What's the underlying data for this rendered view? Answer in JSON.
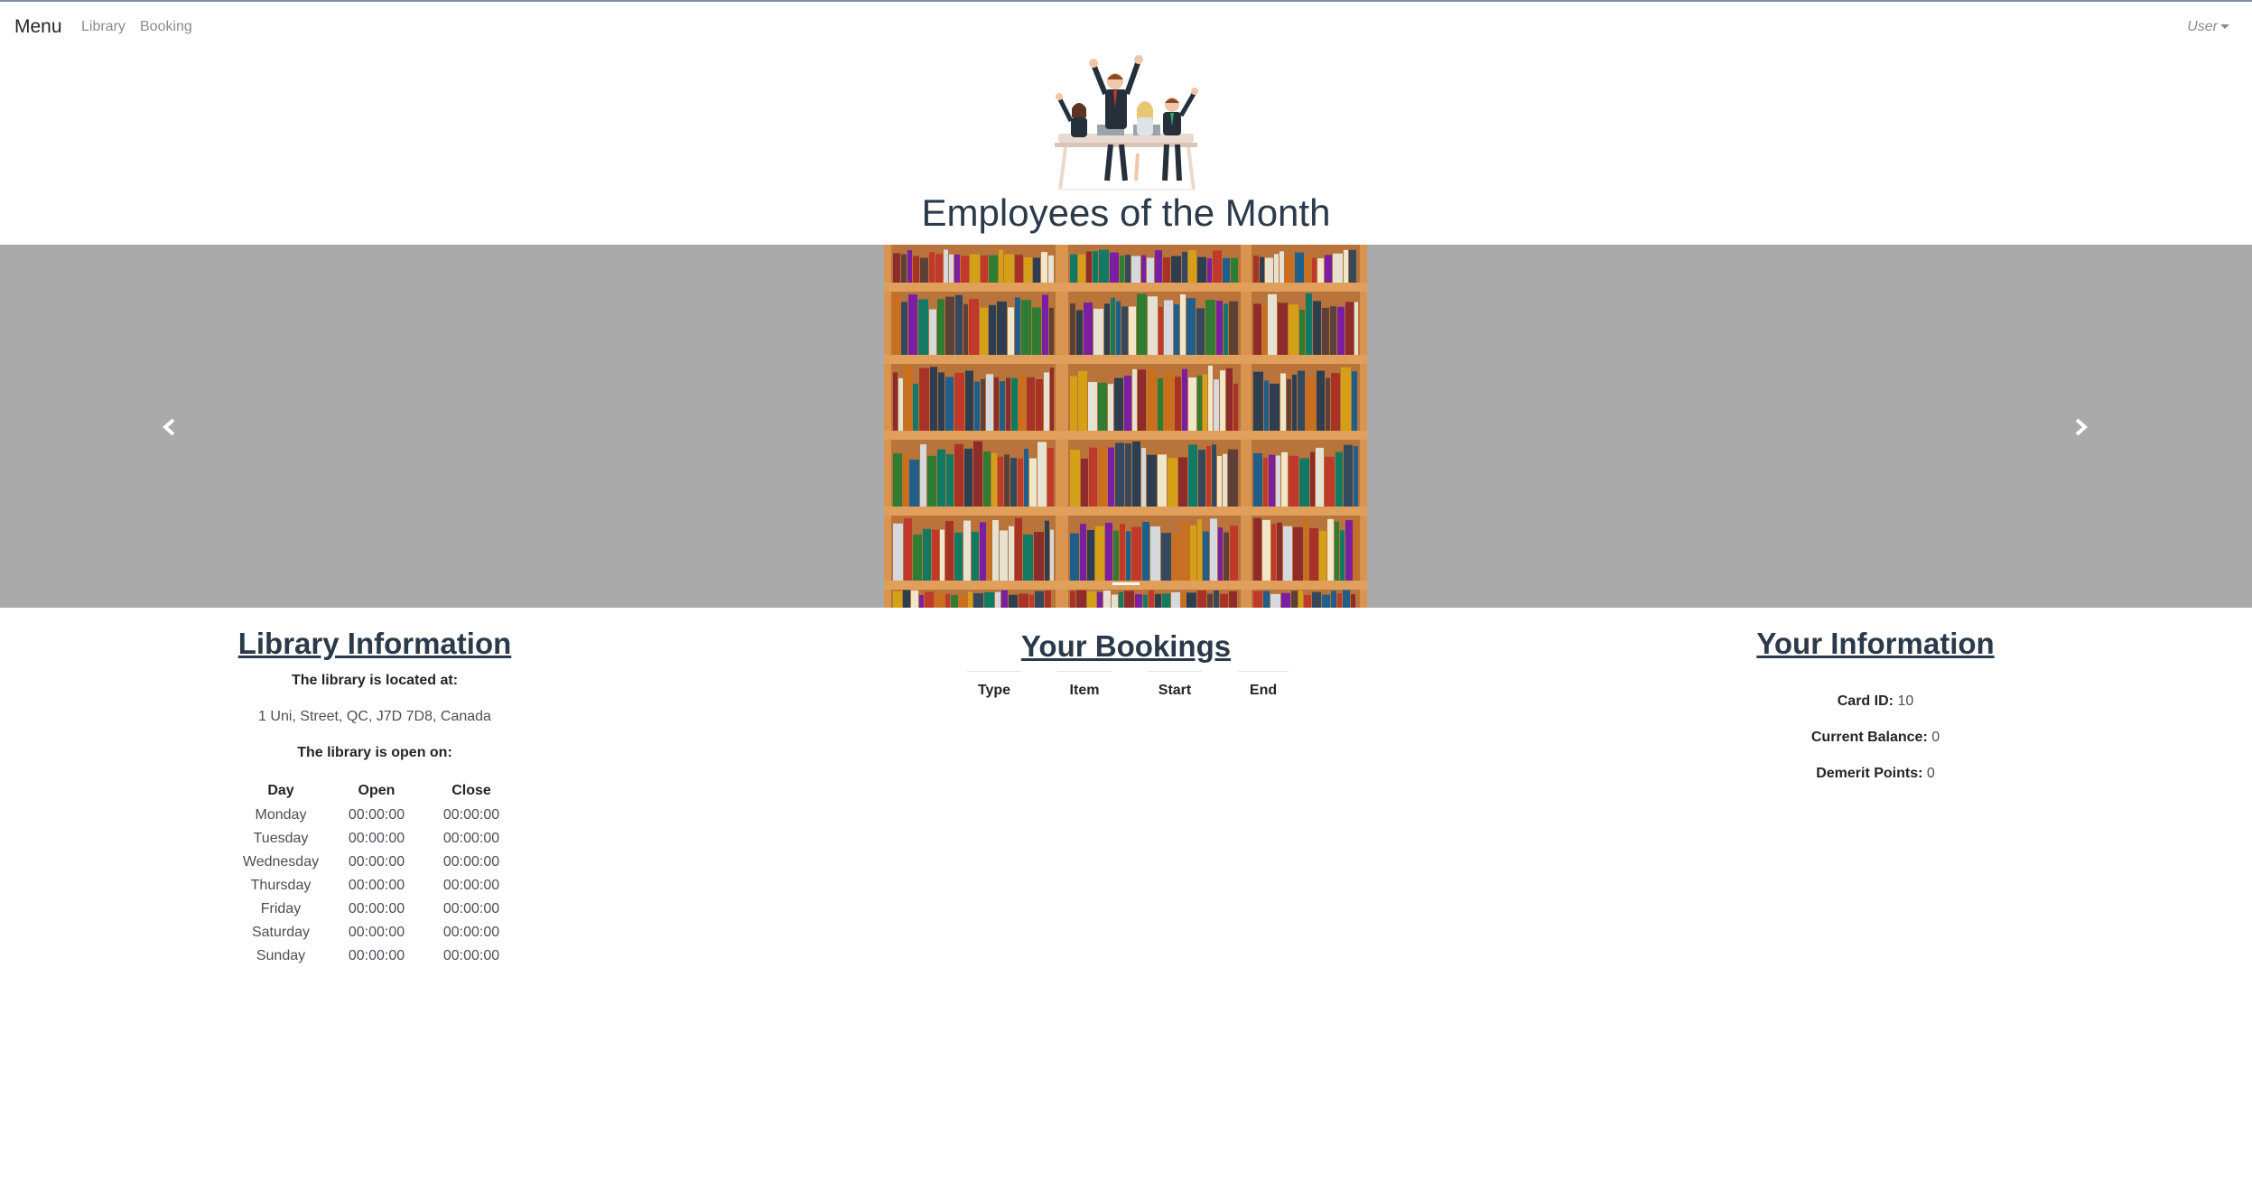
{
  "nav": {
    "brand": "Menu",
    "links": [
      "Library",
      "Booking"
    ],
    "user": "User"
  },
  "hero": {
    "image_icon": "celebrating-employees-illustration",
    "title": "Employees of the Month"
  },
  "carousel": {
    "slide_icon": "bookshelf-photo",
    "prev_icon": "chevron-left-icon",
    "next_icon": "chevron-right-icon",
    "background": "#aaaaaa"
  },
  "library_info": {
    "title": "Library Information",
    "located_label": "The library is located at:",
    "address": "1 Uni, Street, QC, J7D 7D8, Canada",
    "open_label": "The library is open on:",
    "columns": [
      "Day",
      "Open",
      "Close"
    ],
    "rows": [
      [
        "Monday",
        "00:00:00",
        "00:00:00"
      ],
      [
        "Tuesday",
        "00:00:00",
        "00:00:00"
      ],
      [
        "Wednesday",
        "00:00:00",
        "00:00:00"
      ],
      [
        "Thursday",
        "00:00:00",
        "00:00:00"
      ],
      [
        "Friday",
        "00:00:00",
        "00:00:00"
      ],
      [
        "Saturday",
        "00:00:00",
        "00:00:00"
      ],
      [
        "Sunday",
        "00:00:00",
        "00:00:00"
      ]
    ]
  },
  "bookings": {
    "title": "Your Bookings",
    "columns": [
      "Type",
      "Item",
      "Start",
      "End"
    ]
  },
  "user_info": {
    "title": "Your Information",
    "card_id_label": "Card ID:",
    "card_id": "10",
    "balance_label": "Current Balance:",
    "balance": "0",
    "demerit_label": "Demerit Points:",
    "demerit": "0"
  },
  "colors": {
    "heading": "#2b3a4a",
    "nav_muted": "#8c8c8c"
  }
}
